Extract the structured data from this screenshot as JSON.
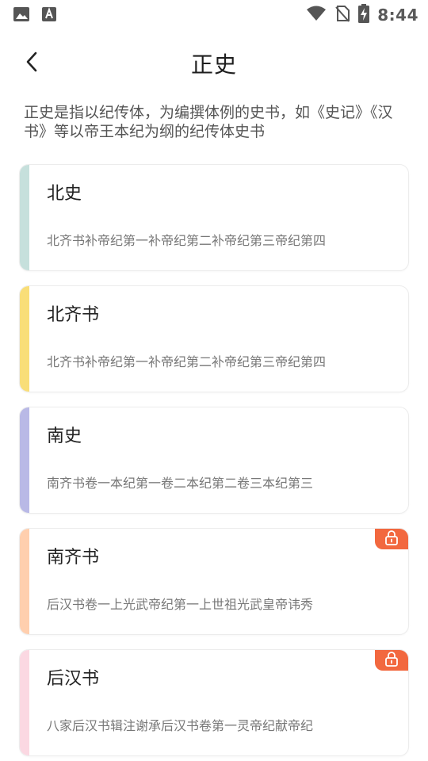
{
  "status_bar": {
    "time": "8:44",
    "icons": [
      "image-icon",
      "font-icon",
      "wifi-icon",
      "no-sim-icon",
      "battery-charging-icon"
    ]
  },
  "header": {
    "title": "正史",
    "back_icon": "chevron-left-icon"
  },
  "description": "正史是指以纪传体，为编撰体例的史书，如《史记》《汉书》等以帝王本纪为纲的纪传体史书",
  "cards": [
    {
      "title": "北史",
      "subtitle": "北齐书补帝纪第一补帝纪第二补帝纪第三帝纪第四",
      "stripe_color": "#c6e0dc",
      "locked": false
    },
    {
      "title": "北齐书",
      "subtitle": "北齐书补帝纪第一补帝纪第二补帝纪第三帝纪第四",
      "stripe_color": "#f9de78",
      "locked": false
    },
    {
      "title": "南史",
      "subtitle": "南齐书卷一本纪第一卷二本纪第二卷三本纪第三",
      "stripe_color": "#b9b9e6",
      "locked": false
    },
    {
      "title": "南齐书",
      "subtitle": "后汉书卷一上光武帝纪第一上世祖光武皇帝讳秀",
      "stripe_color": "#ffcfae",
      "locked": true,
      "lock_icon": "lock-icon",
      "badge_color": "#f2683f"
    },
    {
      "title": "后汉书",
      "subtitle": "八家后汉书辑注谢承后汉书卷第一灵帝纪献帝纪",
      "stripe_color": "#fbd8e2",
      "locked": true,
      "lock_icon": "lock-icon",
      "badge_color": "#f2683f"
    }
  ]
}
